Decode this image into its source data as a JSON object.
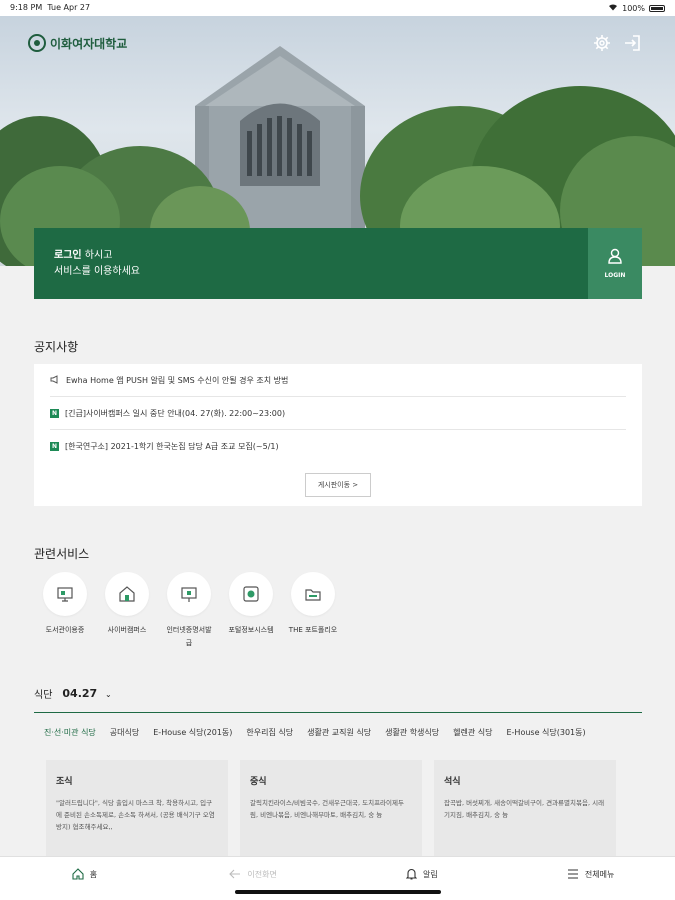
{
  "status_bar": {
    "time": "9:18 PM",
    "date": "Tue Apr 27",
    "battery": "100%"
  },
  "header": {
    "logo_text": "이화여자대학교"
  },
  "login": {
    "line1_bold": "로그인",
    "line1_rest": " 하시고",
    "line2": "서비스를 이용하세요",
    "button_label": "LOGIN"
  },
  "notices": {
    "title": "공지사항",
    "items": [
      {
        "badge": "",
        "text": "Ewha Home 앱 PUSH 알림 및 SMS 수신이 안될 경우 조치 방법"
      },
      {
        "badge": "N",
        "text": "[긴급]사이버캠퍼스 일시 중단 안내(04. 27(화). 22:00~23:00)"
      },
      {
        "badge": "N",
        "text": "[한국연구소] 2021-1학기 한국논집 담당 A급 조교 모집(~5/1)"
      }
    ],
    "more_label": "게시판이동 >"
  },
  "services": {
    "title": "관련서비스",
    "items": [
      {
        "label": "도서관이용증",
        "icon": "library-icon"
      },
      {
        "label": "사이버캠퍼스",
        "icon": "campus-icon"
      },
      {
        "label": "인터넷증명서발급",
        "icon": "certificate-icon"
      },
      {
        "label": "포털정보시스템",
        "icon": "portal-icon"
      },
      {
        "label": "THE 포트폴리오",
        "icon": "folder-icon"
      }
    ]
  },
  "meal": {
    "title": "식단",
    "date": "04.27",
    "tabs": [
      "진·선·미관 식당",
      "공대식당",
      "E-House 식당(201동)",
      "한우리집 식당",
      "생활관 교직원 식당",
      "생활관 학생식당",
      "헬렌관 식당",
      "E-House 식당(301동)"
    ],
    "active_tab": 0,
    "cards": [
      {
        "title": "조식",
        "body": "\"알러드립니다\", 식당 출입시 마스크 착, 착용하시고, 입구에 준비된 손소독제로, 손소독 하셔서, (공용 배식기구 오염방지) 협조해주세요,,"
      },
      {
        "title": "중식",
        "body": "갈릭치킨라이스/비빔국수, 건새우근대국, 도치프라이제두림, 비엔나볶음, 비엔나해부마토, 배추김치, 숭 늉"
      },
      {
        "title": "석식",
        "body": "잡곡밥, 버섯찌개, 새송이떡갈비구이, 견과류멸치볶음, 시래기지짐, 배추김치, 숭 늉"
      }
    ]
  },
  "bottom_nav": {
    "home": "홈",
    "back": "이전화면",
    "alerts": "알림",
    "menu": "전체메뉴"
  }
}
